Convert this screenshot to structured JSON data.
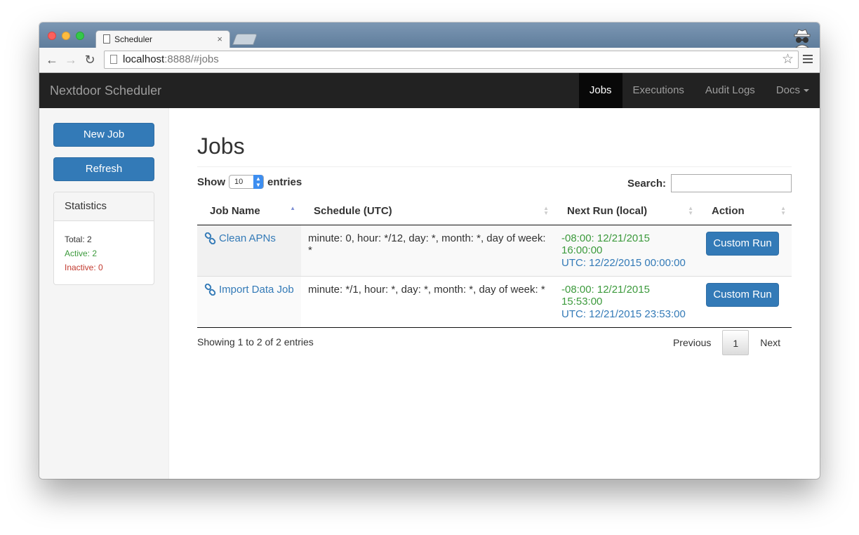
{
  "browser": {
    "tab_title": "Scheduler",
    "tab_close": "×",
    "url_host": "localhost",
    "url_rest": ":8888/#jobs"
  },
  "navbar": {
    "brand": "Nextdoor Scheduler",
    "items": [
      {
        "label": "Jobs",
        "active": true
      },
      {
        "label": "Executions"
      },
      {
        "label": "Audit Logs"
      },
      {
        "label": "Docs"
      }
    ]
  },
  "sidebar": {
    "new_job": "New Job",
    "refresh": "Refresh",
    "stats": {
      "title": "Statistics",
      "total": "Total: 2",
      "active": "Active: 2",
      "inactive": "Inactive: 0"
    }
  },
  "main": {
    "title": "Jobs",
    "show": "Show",
    "page_size": "10",
    "entries": "entries",
    "search_label": "Search:",
    "search_value": ""
  },
  "table": {
    "columns": [
      "Job Name",
      "Schedule (UTC)",
      "Next Run (local)",
      "Action"
    ],
    "rows": [
      {
        "name": "Clean APNs",
        "schedule": "minute: 0, hour: */12, day: *, month: *, day of week: *",
        "next_local": "-08:00: 12/21/2015 16:00:00",
        "next_utc": "UTC: 12/22/2015 00:00:00",
        "action": "Custom Run"
      },
      {
        "name": "Import Data Job",
        "schedule": "minute: */1, hour: *, day: *, month: *, day of week: *",
        "next_local": "-08:00: 12/21/2015 15:53:00",
        "next_utc": "UTC: 12/21/2015 23:53:00",
        "action": "Custom Run"
      }
    ]
  },
  "footer": {
    "info": "Showing 1 to 2 of 2 entries",
    "previous": "Previous",
    "page": "1",
    "next": "Next"
  },
  "colors": {
    "navbar_bg": "#222222",
    "primary": "#337ab7",
    "success": "#3c9a3c",
    "danger": "#c23a2f"
  }
}
